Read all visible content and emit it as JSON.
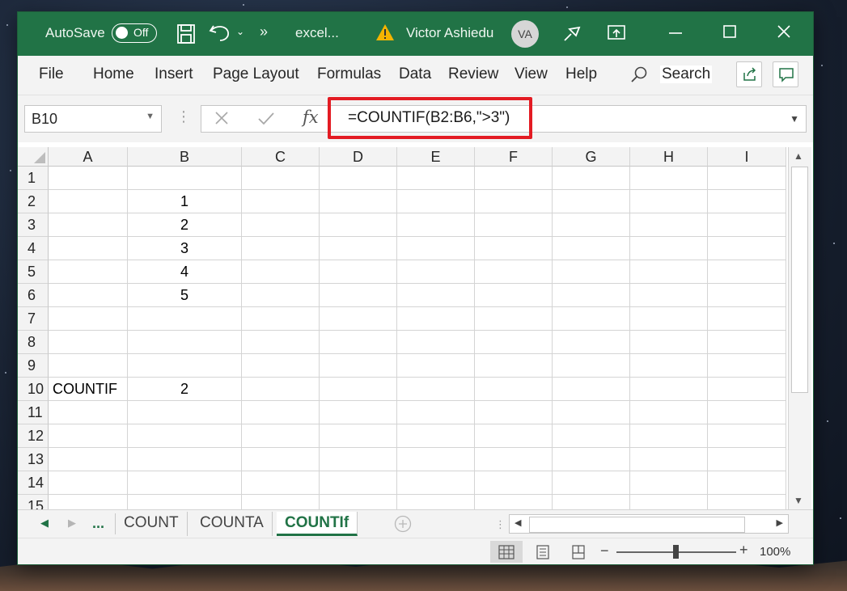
{
  "titlebar": {
    "autosave_label": "AutoSave",
    "autosave_state": "Off",
    "more_glyph": "»",
    "filename": "excel...",
    "user_name": "Victor Ashiedu",
    "user_initials": "VA"
  },
  "menu": {
    "items": [
      "File",
      "Home",
      "Insert",
      "Page Layout",
      "Formulas",
      "Data",
      "Review",
      "View",
      "Help"
    ],
    "search_label": "Search"
  },
  "formula_bar": {
    "name_box": "B10",
    "formula": "=COUNTIF(B2:B6,\">3\")",
    "fx_glyph": "fx"
  },
  "sheet": {
    "columns": [
      "A",
      "B",
      "C",
      "D",
      "E",
      "F",
      "G",
      "H",
      "I"
    ],
    "rows": [
      "1",
      "2",
      "3",
      "4",
      "5",
      "6",
      "7",
      "8",
      "9",
      "10",
      "11",
      "12",
      "13",
      "14",
      "15"
    ],
    "cells": {
      "B2": "1",
      "B3": "2",
      "B4": "3",
      "B5": "4",
      "B6": "5",
      "A10": "COUNTIF",
      "B10": "2"
    }
  },
  "tabs": {
    "ellipsis": "...",
    "items": [
      "COUNT",
      "COUNTA",
      "COUNTIf"
    ],
    "active": "COUNTIf"
  },
  "status": {
    "zoom_label": "100%",
    "zoom_percent": 100
  },
  "colors": {
    "excel_green": "#217346",
    "highlight_red": "#e31b23"
  }
}
